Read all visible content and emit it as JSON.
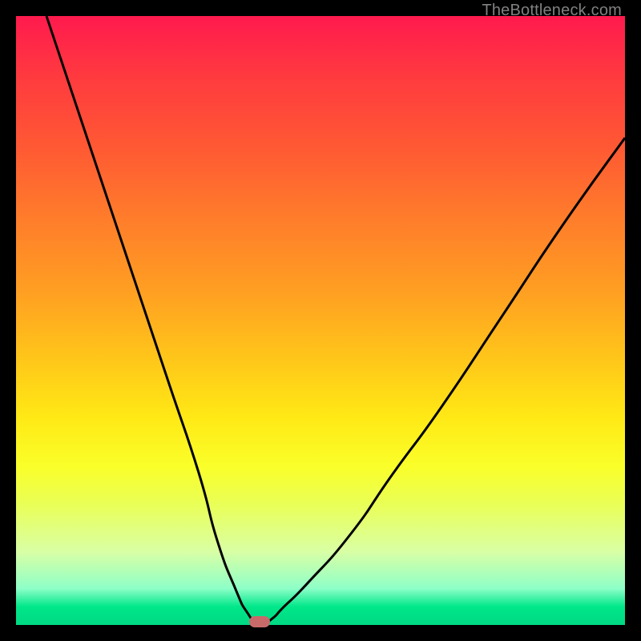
{
  "watermark": "TheBottleneck.com",
  "chart_data": {
    "type": "line",
    "title": "",
    "xlabel": "",
    "ylabel": "",
    "xlim": [
      0,
      100
    ],
    "ylim": [
      0,
      100
    ],
    "grid": false,
    "legend": false,
    "series": [
      {
        "name": "bottleneck-curve",
        "x": [
          5,
          10,
          15,
          20,
          25,
          30,
          33,
          36,
          38,
          40,
          42,
          44,
          48,
          55,
          62,
          70,
          80,
          90,
          100
        ],
        "values": [
          100,
          85,
          70,
          55,
          40,
          25,
          14,
          6,
          2,
          0,
          1,
          3,
          7,
          15,
          25,
          36,
          51,
          66,
          80
        ]
      }
    ],
    "marker": {
      "x": 40,
      "y": 0
    },
    "gradient_colors": {
      "top": "#ff1a4e",
      "bottom": "#00d983"
    }
  }
}
